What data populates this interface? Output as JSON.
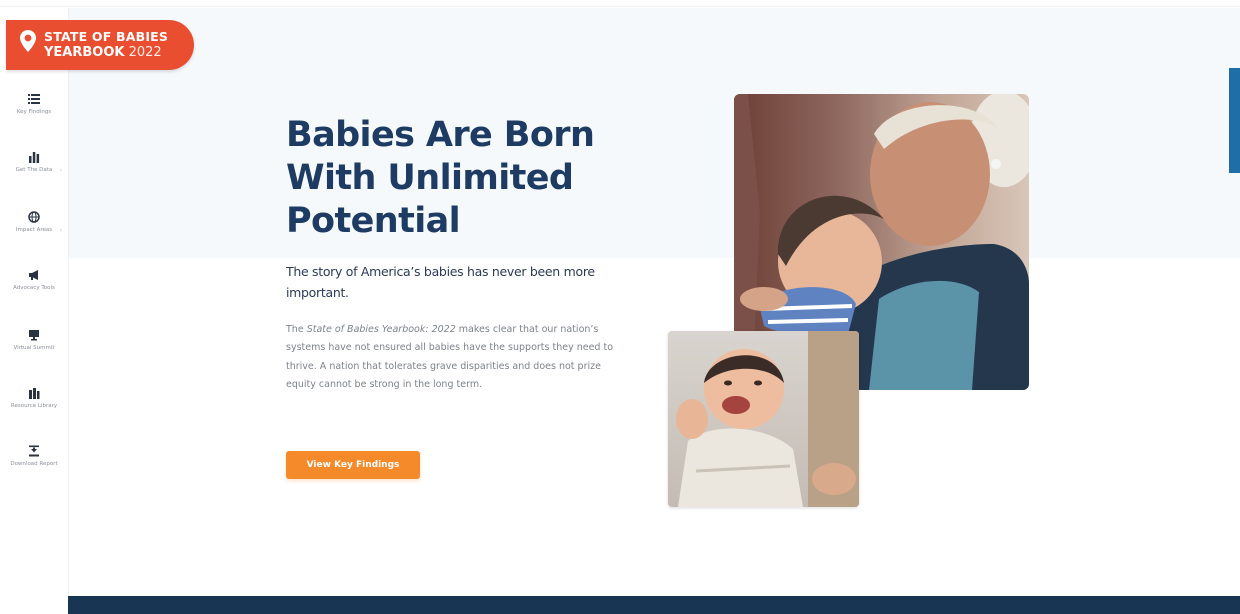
{
  "logo": {
    "line1": "STATE OF BABIES",
    "line2_bold": "YEARBOOK",
    "line2_year": "2022"
  },
  "sidebar": {
    "items": [
      {
        "label": "Key Findings",
        "icon": "list-icon"
      },
      {
        "label": "Get The Data",
        "icon": "bar-chart-icon"
      },
      {
        "label": "Impact Areas",
        "icon": "globe-icon"
      },
      {
        "label": "Advocacy Tools",
        "icon": "megaphone-icon"
      },
      {
        "label": "Virtual Summit",
        "icon": "monitor-icon"
      },
      {
        "label": "Resource Library",
        "icon": "library-icon"
      },
      {
        "label": "Download Report",
        "icon": "download-icon"
      }
    ]
  },
  "hero": {
    "headline": "Babies Are Born With Unlimited Potential",
    "subhead": "The story of America’s babies has never been more important.",
    "body_prefix": "The ",
    "body_italic": "State of Babies Yearbook: 2022",
    "body_suffix": " makes clear that our nation’s systems have not ensured all babies have the supports they need to thrive. A nation that tolerates grave disparities and does not prize equity cannot be strong in the long term.",
    "cta_label": "View Key Findings"
  },
  "colors": {
    "brand_orange_red": "#e94e31",
    "cta_orange": "#f58a2a",
    "navy": "#1d3b63",
    "footer_navy": "#183554"
  }
}
